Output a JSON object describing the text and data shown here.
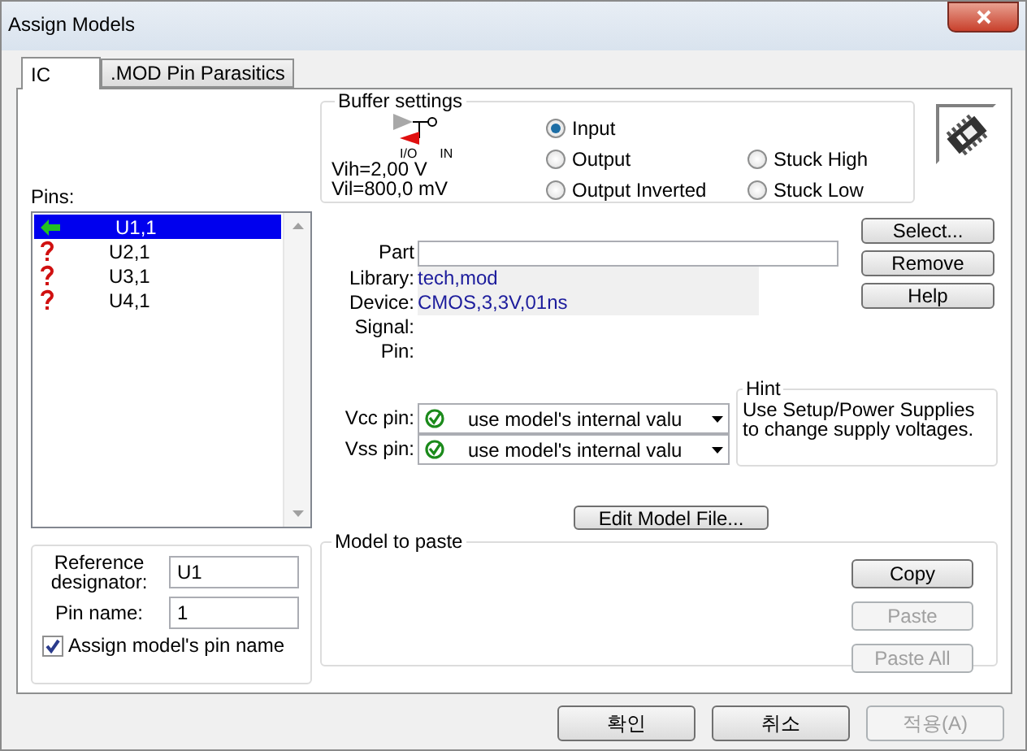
{
  "window": {
    "title": "Assign Models"
  },
  "tabs": [
    {
      "label": "IC",
      "selected": true
    },
    {
      "label": ".MOD Pin Parasitics",
      "selected": false
    }
  ],
  "buffer_settings": {
    "title": "Buffer settings",
    "diagram_labels": [
      "I/O",
      "IN"
    ],
    "vih": "Vih=2,00 V",
    "vil": "Vil=800,0 mV",
    "modes": [
      {
        "label": "Input",
        "selected": true
      },
      {
        "label": "Output",
        "selected": false
      },
      {
        "label": "Output Inverted",
        "selected": false
      },
      {
        "label": "Stuck High",
        "selected": false
      },
      {
        "label": "Stuck Low",
        "selected": false
      }
    ]
  },
  "pins": {
    "label": "Pins:",
    "items": [
      {
        "name": "U1,1",
        "kind": "assigned",
        "selected": true
      },
      {
        "name": "U2,1",
        "kind": "unknown",
        "selected": false
      },
      {
        "name": "U3,1",
        "kind": "unknown",
        "selected": false
      },
      {
        "name": "U4,1",
        "kind": "unknown",
        "selected": false
      }
    ]
  },
  "part": {
    "label": "Part"
  },
  "info": [
    {
      "label": "Library:",
      "value": "tech,mod"
    },
    {
      "label": "Device:",
      "value": "CMOS,3,3V,01ns"
    },
    {
      "label": "Signal:"
    },
    {
      "label": "Pin:"
    }
  ],
  "side_buttons": [
    "Select...",
    "Remove",
    "Help"
  ],
  "power": [
    {
      "label": "Vcc pin:",
      "value": "use model's internal valu"
    },
    {
      "label": "Vss pin:",
      "value": "use model's internal valu"
    }
  ],
  "hint": {
    "title": "Hint",
    "text": "Use Setup/Power Supplies to change supply voltages."
  },
  "edit_button": "Edit Model File...",
  "reference": {
    "designator_label": "Reference designator:",
    "designator": "U1",
    "pin_name_label": "Pin name:",
    "pin_name": "1",
    "assign_label": "Assign model's pin name",
    "assign_checked": true
  },
  "model_to_paste": {
    "title": "Model to paste",
    "buttons": [
      {
        "label": "Copy",
        "disabled": false
      },
      {
        "label": "Paste",
        "disabled": true
      },
      {
        "label": "Paste All",
        "disabled": true
      }
    ]
  },
  "dialog_buttons": [
    {
      "label": "확인",
      "disabled": false
    },
    {
      "label": "취소",
      "disabled": false
    },
    {
      "label": "적용(A)",
      "disabled": true
    }
  ]
}
